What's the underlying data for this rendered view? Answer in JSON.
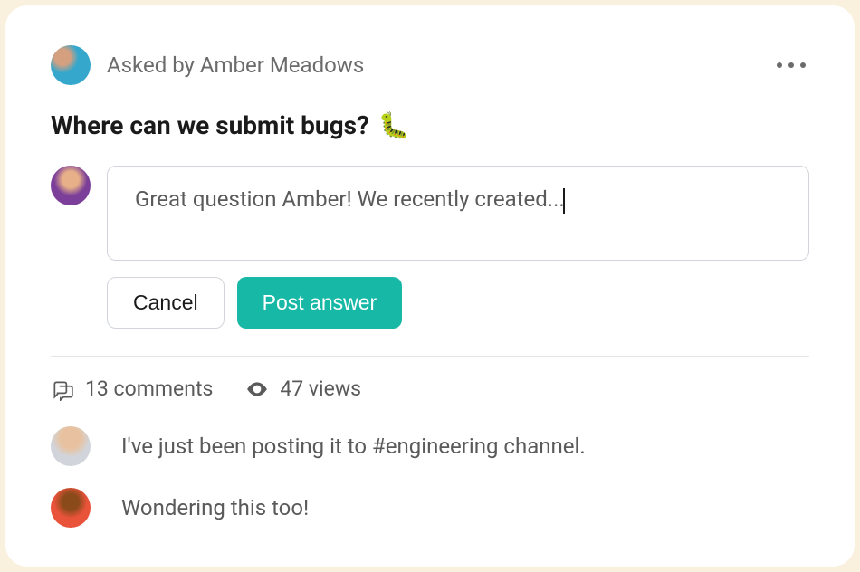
{
  "post": {
    "asked_by_prefix": "Asked by ",
    "author": "Amber Meadows",
    "asked_by_full": "Asked by Amber Meadows",
    "title": "Where can we submit bugs?",
    "emoji": "🐛"
  },
  "answer": {
    "draft_text": "Great question Amber! We recently created..."
  },
  "buttons": {
    "cancel": "Cancel",
    "post": "Post answer"
  },
  "stats": {
    "comments_count": 13,
    "comments_label": "13 comments",
    "views_count": 47,
    "views_label": "47 views"
  },
  "comments": [
    {
      "text": "I've just been posting it to #engineering channel."
    },
    {
      "text": "Wondering this too!"
    }
  ]
}
